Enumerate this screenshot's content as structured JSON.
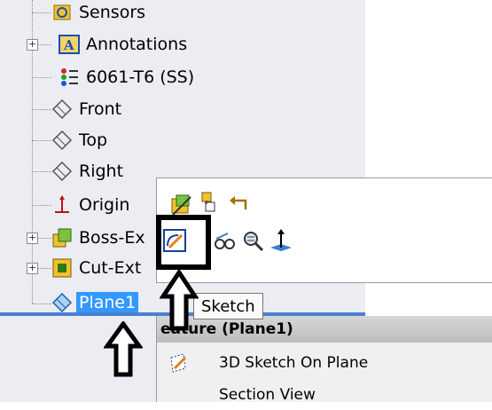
{
  "tree": {
    "items": [
      {
        "label": "Sensors",
        "icon": "sensors-icon"
      },
      {
        "label": "Annotations",
        "icon": "annotations-icon"
      },
      {
        "label": "6061-T6 (SS)",
        "icon": "material-icon"
      },
      {
        "label": "Front",
        "icon": "plane-icon"
      },
      {
        "label": "Top",
        "icon": "plane-icon"
      },
      {
        "label": "Right",
        "icon": "plane-icon"
      },
      {
        "label": "Origin",
        "icon": "origin-icon"
      },
      {
        "label": "Boss-Ex",
        "icon": "boss-extrude-icon"
      },
      {
        "label": "Cut-Ext",
        "icon": "cut-extrude-icon"
      },
      {
        "label": "Plane1",
        "icon": "plane-icon",
        "selected": true
      }
    ]
  },
  "toolbar": {
    "row1": [
      "edit-feature-icon",
      "copy-icon",
      "rollback-icon"
    ],
    "row2": [
      "sketch-icon",
      "hide-show-icon",
      "zoom-to-selection-icon",
      "normal-to-icon"
    ]
  },
  "tooltip": {
    "text": "Sketch"
  },
  "context_menu": {
    "header": "eature (Plane1)",
    "items": [
      {
        "label": "3D Sketch On Plane",
        "icon": "3d-sketch-icon"
      },
      {
        "label": "Section View",
        "icon": ""
      }
    ]
  },
  "colors": {
    "selection": "#3399ff",
    "separator": "#4a7fd0",
    "panel": "#ebedf2"
  }
}
